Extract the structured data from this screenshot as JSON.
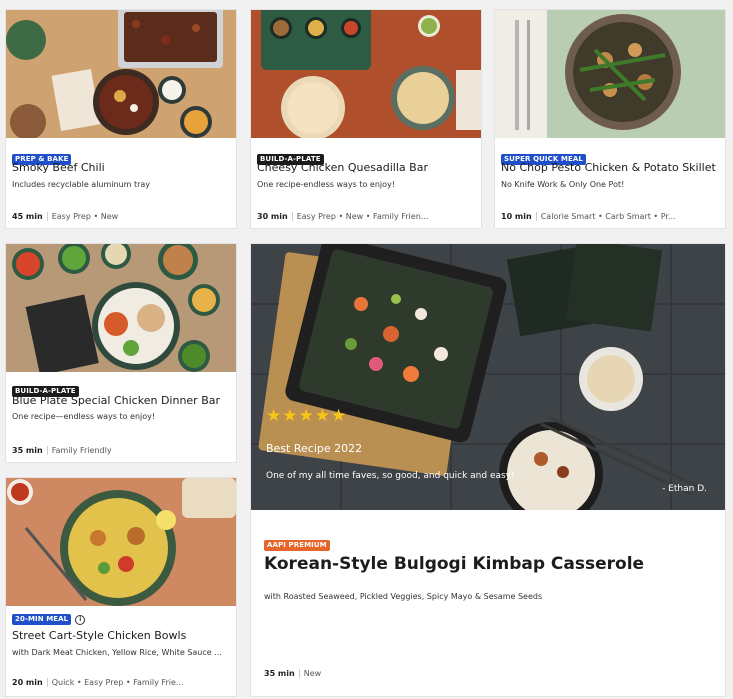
{
  "cards": [
    {
      "badge": "PREP & BAKE",
      "title": "Smoky Beef Chili",
      "subtitle": "Includes recyclable aluminum tray",
      "time": "45 min",
      "tags": "Easy Prep • New"
    },
    {
      "badge": "BUILD-A-PLATE",
      "title": "Cheesy Chicken Quesadilla Bar",
      "subtitle": "One recipe-endless ways to enjoy!",
      "time": "30 min",
      "tags": "Easy Prep • New • Family Frien..."
    },
    {
      "badge": "SUPER QUICK MEAL",
      "title": "No Chop Pesto Chicken & Potato Skillet",
      "subtitle": "No Knife Work & Only One Pot!",
      "time": "10 min",
      "tags": "Calorie Smart • Carb Smart • Pr..."
    },
    {
      "badge": "BUILD-A-PLATE",
      "title": "Blue Plate Special Chicken Dinner Bar",
      "subtitle": "One recipe—endless ways to enjoy!",
      "time": "35 min",
      "tags": "Family Friendly"
    },
    {
      "badge": "20-MIN MEAL",
      "title": "Street Cart-Style Chicken Bowls",
      "subtitle": "with Dark Meat Chicken, Yellow Rice, White Sauce ...",
      "time": "20 min",
      "tags": "Quick • Easy Prep • Family Frie..."
    }
  ],
  "featured": {
    "stars": "★★★★★",
    "review_title": "Best Recipe 2022",
    "review_text": "One of my all time faves, so good, and quick and easy!",
    "review_author": "- Ethan D.",
    "badge": "AAPI PREMIUM",
    "title": "Korean-Style Bulgogi Kimbap Casserole",
    "subtitle": "with Roasted Seaweed, Pickled Veggies, Spicy Mayo & Sesame Seeds",
    "time": "35 min",
    "tags": "New"
  },
  "colors": {
    "badge_dark": "#1b1b1b",
    "badge_blue": "#1f4fc9",
    "badge_orange": "#e6652a",
    "star": "#f5c518"
  }
}
